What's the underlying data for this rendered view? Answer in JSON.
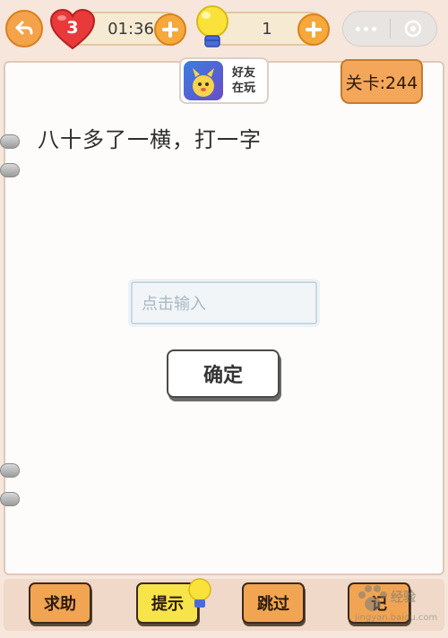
{
  "topbar": {
    "lives": "3",
    "timer": "01:36",
    "hints": "1"
  },
  "friends_badge": {
    "line1": "好友",
    "line2": "在玩"
  },
  "level": {
    "label": "关卡:244"
  },
  "question": {
    "text": "八十多了一横，打一字"
  },
  "answer_input": {
    "placeholder": "点击输入"
  },
  "confirm": {
    "label": "确定"
  },
  "bottom": {
    "help": "求助",
    "hint": "提示",
    "skip": "跳过",
    "fourth": "记"
  },
  "watermark": {
    "brand": "经验",
    "url": "jingyan.baidu.com"
  },
  "colors": {
    "accent_orange": "#f4a34a",
    "heart_red": "#e83a3a",
    "hint_yellow": "#f7e44a",
    "background": "#f6e6dc"
  }
}
